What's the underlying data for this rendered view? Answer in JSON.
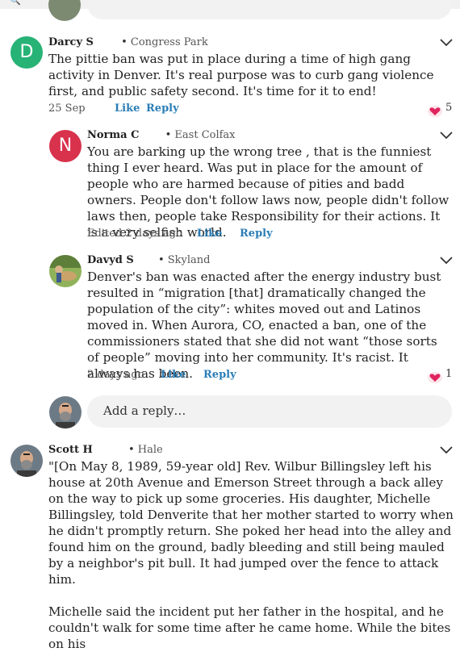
{
  "comments": [
    {
      "avatar_letter": "D",
      "avatar_color": "#27b376",
      "name": "Darcy S",
      "neighborhood": "Congress Park",
      "text": "The pittie ban was put in place during a time of high gang activity in Denver. It's real purpose was to curb gang violence first, and public safety second. It's time for it to end!",
      "time": "25 Sep",
      "like_label": "Like",
      "reply_label": "Reply",
      "like_count": "5"
    },
    {
      "avatar_letter": "N",
      "avatar_color": "#d8324c",
      "name": "Norma C",
      "neighborhood": "East Colfax",
      "text": "You are barking up the wrong tree , that is the funniest thing I ever heard.   Was put in place for the amount of people who are harmed because of pities and badd owners.  People don't follow laws now, people didn't follow laws then, people take Responsibility for their actions. It is a very selfish world.",
      "time": "Edited 2 days ago",
      "like_label": "Like",
      "reply_label": "Reply"
    },
    {
      "name": "Davyd S",
      "neighborhood": "Skyland",
      "text": "Denver's ban was enacted after the energy industry bust resulted in “migration [that] dramatically changed the population of the city”: whites moved out and Latinos moved in. When Aurora, CO, enacted a ban, one of the commissioners stated that she did not want “those sorts of people” moving into her community.  It's racist.  It always has been.",
      "time": "2 days ago",
      "like_label": "Like",
      "reply_label": "Reply",
      "like_count": "1"
    },
    {
      "name": "Scott H",
      "neighborhood": "Hale",
      "text_p1": "\"[On May 8, 1989, 59-year old] Rev. Wilbur Billingsley left his house at 20th Avenue and Emerson Street through a back alley on the way to pick up some groceries. His daughter, Michelle Billingsley, told Denverite that her mother started to worry when he didn't promptly return. She poked her head into the alley and found him on the ground, badly bleeding and still being mauled by a neighbor's pit bull. It had jumped over the fence to attack him.",
      "text_p2": "Michelle said the incident put her father in the hospital, and he couldn't walk for some time after he came home. While the bites on his"
    }
  ],
  "reply_input": {
    "placeholder": "Add a reply…"
  },
  "colors": {
    "accent": "#2a7db6",
    "heart": "#e0245e"
  }
}
